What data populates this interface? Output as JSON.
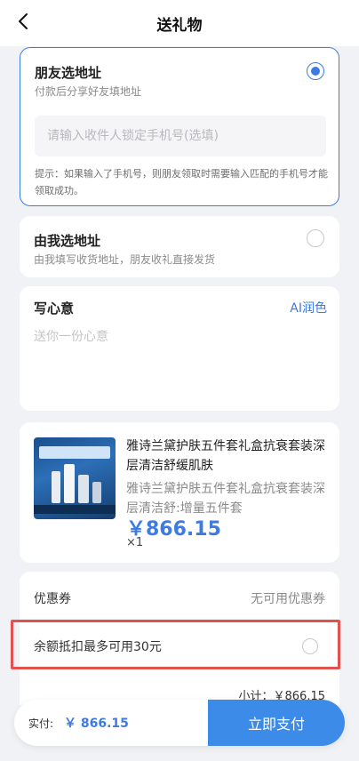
{
  "header": {
    "title": "送礼物"
  },
  "friend_option": {
    "title": "朋友选地址",
    "subtitle": "付款后分享好友填地址",
    "phone_placeholder": "请输入收件人锁定手机号(选填)",
    "tip": "提示：如果输入了手机号，则朋友领取时需要输入匹配的手机号才能领取成功。",
    "selected": true
  },
  "self_option": {
    "title": "由我选地址",
    "subtitle": "由我填写收货地址，朋友收礼直接发货",
    "selected": false
  },
  "note": {
    "title": "写心意",
    "ai_button": "AI润色",
    "placeholder": "送你一份心意"
  },
  "product": {
    "name": "雅诗兰黛护肤五件套礼盒抗衰套装深层清洁舒缓肌肤",
    "spec": "雅诗兰黛护肤五件套礼盒抗衰套装深层清洁舒:增量五件套",
    "price": "￥866.15",
    "quantity": "×1",
    "image_icon": "product-thumbnail"
  },
  "coupon": {
    "label": "优惠券",
    "value": "无可用优惠券"
  },
  "balance": {
    "label": "余额抵扣最多可用30元",
    "checked": false
  },
  "subtotal": "小计：￥866.15",
  "footer": {
    "paid_label": "实付:",
    "paid_amount": "￥ 866.15",
    "pay_button": "立即支付"
  },
  "colors": {
    "accent": "#3d7be3",
    "pay_button": "#3d8be8",
    "highlight_box": "#e0514f",
    "background": "#f1f2f5"
  }
}
